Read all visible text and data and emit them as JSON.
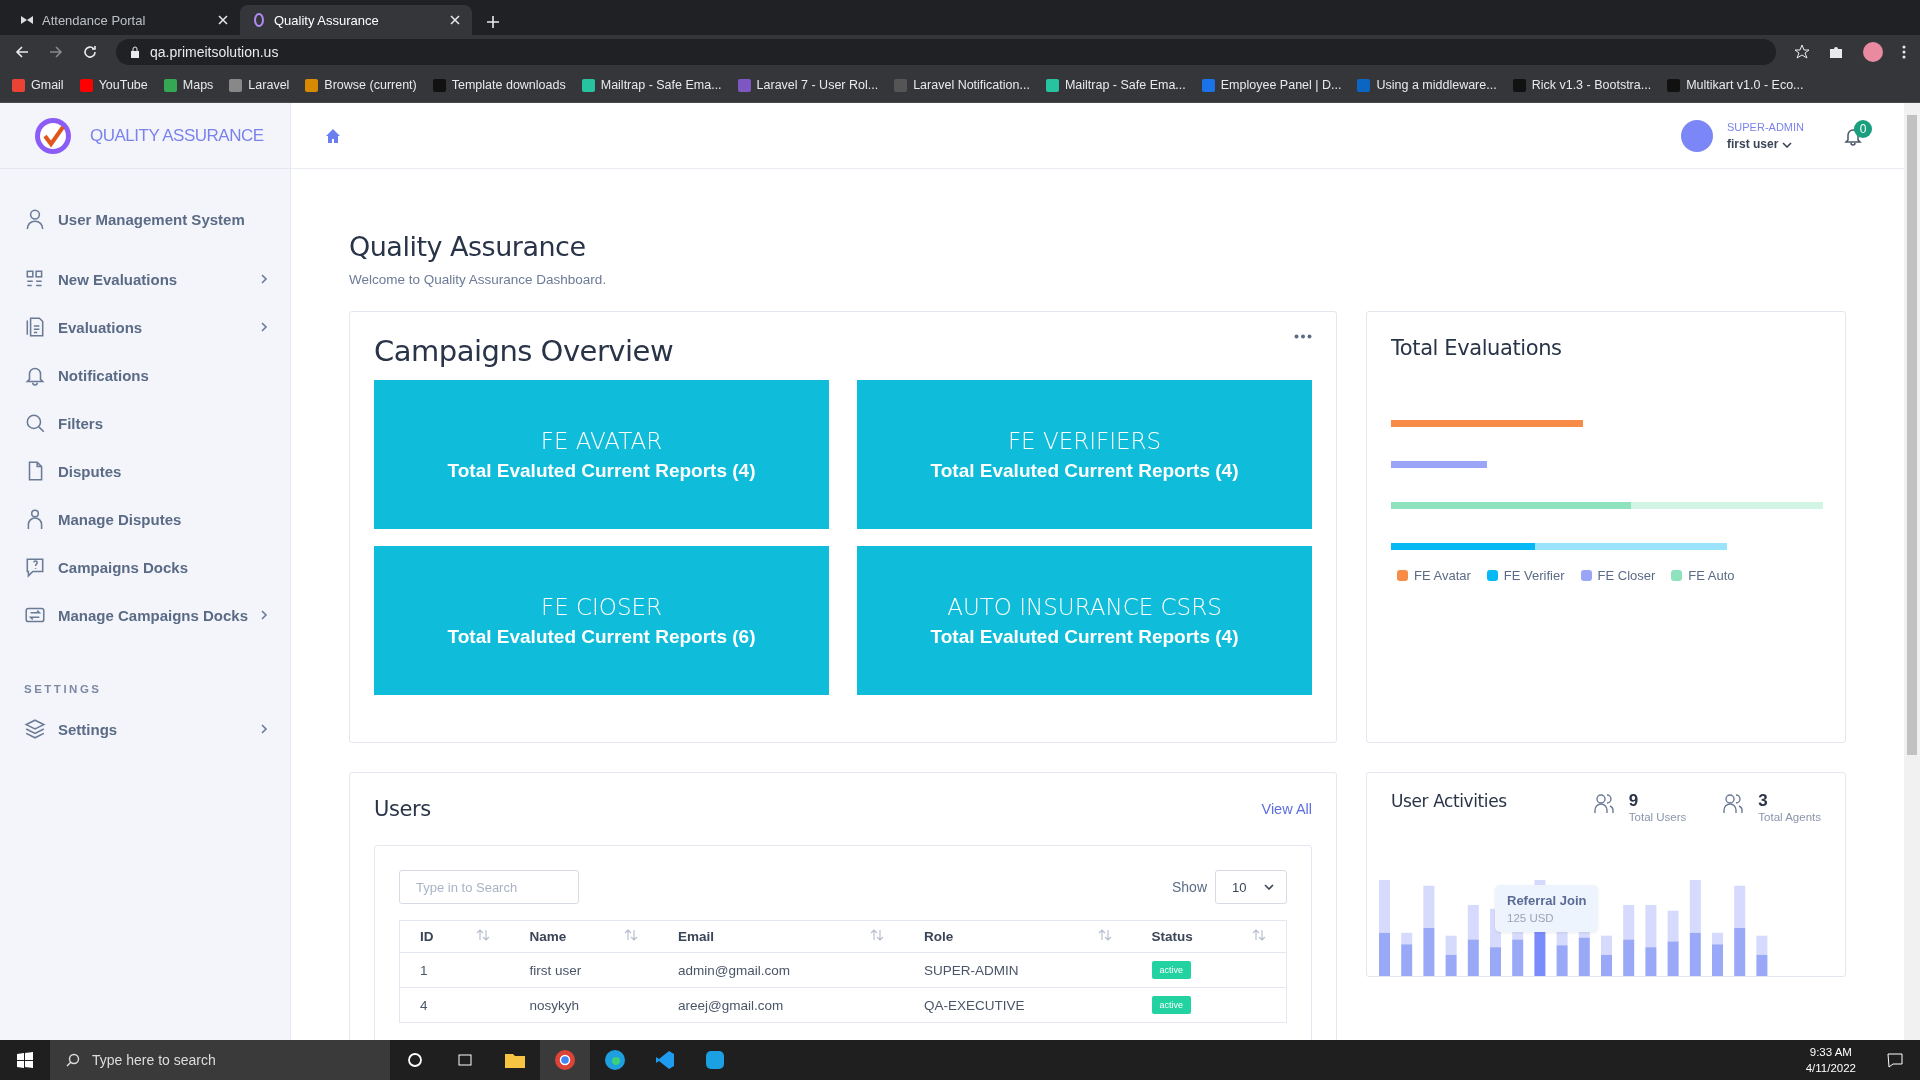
{
  "browser": {
    "tabs": [
      {
        "title": "Attendance Portal",
        "selected": false
      },
      {
        "title": "Quality Assurance",
        "selected": true
      }
    ],
    "url": "qa.primeitsolution.us",
    "bookmarks": [
      "Gmail",
      "YouTube",
      "Maps",
      "Laravel",
      "Browse (current)",
      "Template downloads",
      "Mailtrap - Safe Ema...",
      "Laravel 7 - User Rol...",
      "Laravel Notification...",
      "Mailtrap - Safe Ema...",
      "Employee Panel | D...",
      "Using a middleware...",
      "Rick v1.3 - Bootstra...",
      "Multikart v1.0 - Eco..."
    ]
  },
  "sidebar": {
    "logo_text": "QUALITY ASSURANCE",
    "items": [
      {
        "label": "User Management System",
        "expandable": false
      },
      {
        "label": "New Evaluations",
        "expandable": true
      },
      {
        "label": "Evaluations",
        "expandable": true
      },
      {
        "label": "Notifications",
        "expandable": false
      },
      {
        "label": "Filters",
        "expandable": false
      },
      {
        "label": "Disputes",
        "expandable": false
      },
      {
        "label": "Manage Disputes",
        "expandable": false
      },
      {
        "label": "Campaigns Docks",
        "expandable": false
      },
      {
        "label": "Manage Campaigns Docks",
        "expandable": true
      }
    ],
    "section": "SETTINGS",
    "settings_items": [
      {
        "label": "Settings",
        "expandable": true
      }
    ]
  },
  "header": {
    "role": "SUPER-ADMIN",
    "user": "first user",
    "notifications": "0"
  },
  "page": {
    "title": "Quality Assurance",
    "subtitle": "Welcome to Quality Assurance Dashboard."
  },
  "campaigns": {
    "title": "Campaigns Overview",
    "tiles": [
      {
        "name": "FE AVATAR",
        "caption": "Total Evaluted Current Reports (4)"
      },
      {
        "name": "FE VERIFIERS",
        "caption": "Total Evaluted Current Reports (4)"
      },
      {
        "name": "FE CIOSER",
        "caption": "Total Evaluted Current Reports (6)"
      },
      {
        "name": "AUTO INSURANCE CSRS",
        "caption": "Total Evaluted Current Reports (4)"
      }
    ]
  },
  "total_evaluations": {
    "title": "Total Evaluations",
    "legend": [
      {
        "label": "FE Avatar",
        "color": "#f68c45"
      },
      {
        "label": "FE Verifier",
        "color": "#04b9f4"
      },
      {
        "label": "FE Closer",
        "color": "#9aa5f7"
      },
      {
        "label": "FE Auto",
        "color": "#8ee3be"
      }
    ]
  },
  "users": {
    "title": "Users",
    "view_all": "View All",
    "search_placeholder": "Type in to Search",
    "show_label": "Show",
    "show_value": "10",
    "columns": [
      "ID",
      "Name",
      "Email",
      "Role",
      "Status"
    ],
    "rows": [
      {
        "cells": [
          "1",
          "first user",
          "admin@gmail.com",
          "SUPER-ADMIN"
        ],
        "status": "active"
      },
      {
        "cells": [
          "4",
          "nosykyh",
          "areej@gmail.com",
          "QA-EXECUTIVE"
        ],
        "status": "active"
      }
    ]
  },
  "user_activities": {
    "title": "User Activities",
    "stats": [
      {
        "value": "9",
        "label": "Total Users"
      },
      {
        "value": "3",
        "label": "Total Agents"
      }
    ],
    "tooltip": {
      "title": "Referral Join",
      "value": "125 USD"
    }
  },
  "taskbar": {
    "search_placeholder": "Type here to search",
    "time": "9:33 AM",
    "date": "4/11/2022"
  }
}
